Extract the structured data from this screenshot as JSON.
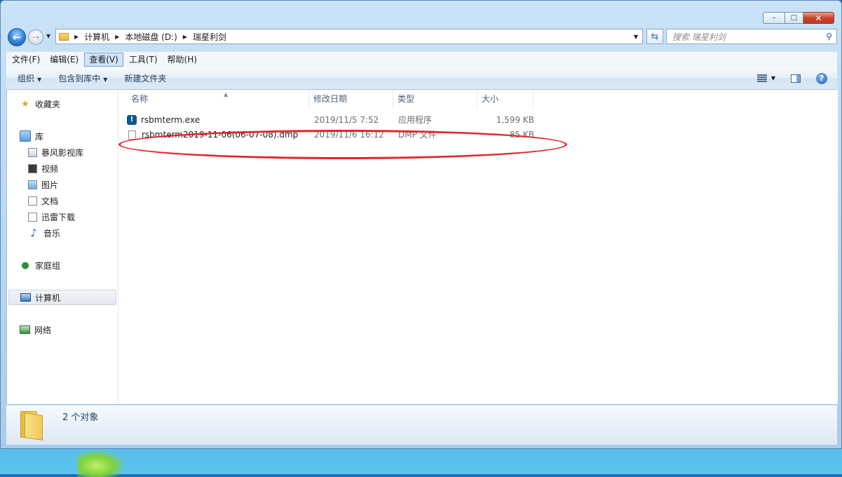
{
  "window": {
    "caption": {
      "minimize": "–",
      "maximize": "□",
      "close": "✕"
    }
  },
  "navbar": {
    "back_glyph": "←",
    "forward_glyph": "→",
    "dropdown_glyph": "▼",
    "breadcrumbs": [
      "计算机",
      "本地磁盘 (D:)",
      "瑞星利剑"
    ],
    "refresh_glyph": "⇆",
    "search_placeholder": "搜索 瑞星利剑",
    "search_icon_glyph": "⚲"
  },
  "menubar": {
    "items": [
      "文件(F)",
      "编辑(E)",
      "查看(V)",
      "工具(T)",
      "帮助(H)"
    ],
    "active_index": 2
  },
  "toolbar": {
    "organize": "组织",
    "include_in_library": "包含到库中",
    "new_folder": "新建文件夹",
    "dropdown_glyph": "▼",
    "help_glyph": "?"
  },
  "sidebar": {
    "favorites": "收藏夹",
    "libraries": "库",
    "library_items": [
      "暴风影视库",
      "视频",
      "图片",
      "文档",
      "迅雷下载",
      "音乐"
    ],
    "homegroup": "家庭组",
    "computer": "计算机",
    "network": "网络",
    "selected": "计算机"
  },
  "file_list": {
    "columns": [
      "名称",
      "修改日期",
      "类型",
      "大小"
    ],
    "sort_glyph": "▲",
    "rows": [
      {
        "name": "rsbmterm.exe",
        "date": "2019/11/5 7:52",
        "type": "应用程序",
        "size": "1,599 KB",
        "icon": "exe-icon"
      },
      {
        "name": "rsbmterm2019-11-06(06-07-08).dmp",
        "date": "2019/11/6 16:12",
        "type": "DMP 文件",
        "size": "85 KB",
        "icon": "document-icon"
      }
    ]
  },
  "details": {
    "item_count": "2 个对象"
  },
  "colors": {
    "highlight": "#e0262a",
    "accent": "#2f7fd6"
  }
}
